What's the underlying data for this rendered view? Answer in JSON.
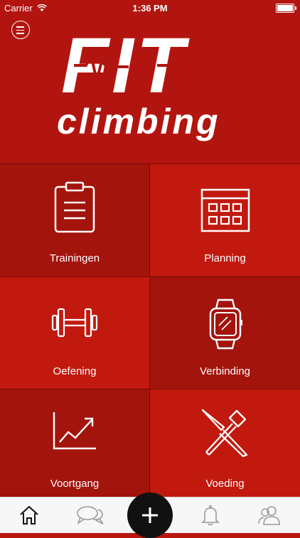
{
  "status_bar": {
    "carrier": "Carrier",
    "time": "1:36 PM"
  },
  "logo": {
    "line1": "FIT",
    "line2": "climbing"
  },
  "tiles": [
    {
      "label": "Trainingen",
      "icon": "clipboard-icon"
    },
    {
      "label": "Planning",
      "icon": "calendar-icon"
    },
    {
      "label": "Oefening",
      "icon": "dumbbell-icon"
    },
    {
      "label": "Verbinding",
      "icon": "smartwatch-icon"
    },
    {
      "label": "Voortgang",
      "icon": "chart-icon"
    },
    {
      "label": "Voeding",
      "icon": "fork-knife-icon"
    }
  ],
  "tabbar": {
    "items": [
      "home-icon",
      "chat-icon",
      "plus-icon",
      "bell-icon",
      "users-icon"
    ]
  },
  "colors": {
    "header": "#b2150f",
    "tile_dark": "#a3140d",
    "tile_light": "#c2190f"
  }
}
